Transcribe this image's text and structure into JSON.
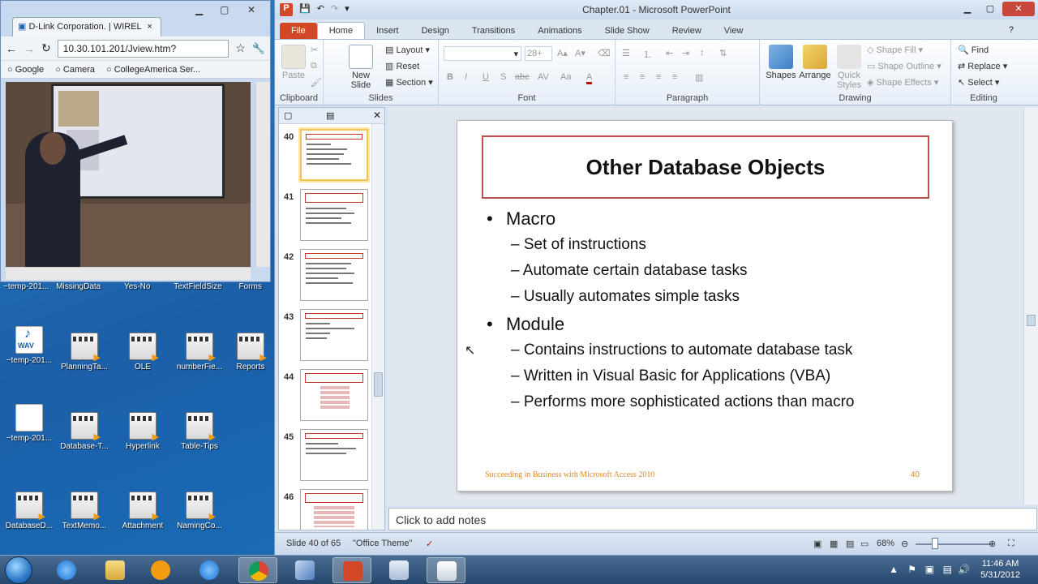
{
  "browser": {
    "tab_title": "D-Link Corporation. | WIREL",
    "url": "10.30.101.201/Jview.htm?",
    "bookmarks": [
      "Google",
      "Camera",
      "CollegeAmerica Ser..."
    ],
    "strip_labels": [
      "~temp-201...",
      "MissingData",
      "Yes-No",
      "TextFieldSize",
      "Forms"
    ]
  },
  "desktop": {
    "icons": [
      {
        "label": "~temp-201...",
        "type": "wav"
      },
      {
        "label": "PlanningTa...",
        "type": "video"
      },
      {
        "label": "OLE",
        "type": "video"
      },
      {
        "label": "numberFie...",
        "type": "video"
      },
      {
        "label": "Reports",
        "type": "video"
      },
      {
        "label": "~temp-201...",
        "type": "doc"
      },
      {
        "label": "Database-T...",
        "type": "video"
      },
      {
        "label": "Hyperlink",
        "type": "video"
      },
      {
        "label": "Table-Tips",
        "type": "video"
      },
      {
        "label": "DatabaseD...",
        "type": "video"
      },
      {
        "label": "TextMemo...",
        "type": "video"
      },
      {
        "label": "Attachment",
        "type": "video"
      },
      {
        "label": "NamingCo...",
        "type": "video"
      }
    ],
    "wav_text": "WAV"
  },
  "ppt": {
    "window_title": "Chapter.01 - Microsoft PowerPoint",
    "app_letter": "P",
    "tabs": [
      "File",
      "Home",
      "Insert",
      "Design",
      "Transitions",
      "Animations",
      "Slide Show",
      "Review",
      "View"
    ],
    "active_tab": "Home",
    "ribbon": {
      "groups": [
        "Clipboard",
        "Slides",
        "Font",
        "Paragraph",
        "Drawing",
        "Editing"
      ],
      "paste": "Paste",
      "new_slide": "New Slide",
      "layout": "Layout",
      "reset": "Reset",
      "section": "Section",
      "font_size": "28+",
      "font_buttons": [
        "B",
        "I",
        "U",
        "S",
        "abc",
        "AV",
        "Aa",
        "A"
      ],
      "shapes": "Shapes",
      "arrange": "Arrange",
      "quick_styles": "Quick Styles",
      "shape_fill": "Shape Fill",
      "shape_outline": "Shape Outline",
      "shape_effects": "Shape Effects",
      "find": "Find",
      "replace": "Replace",
      "select": "Select"
    },
    "thumbnails": [
      {
        "num": "40",
        "selected": true
      },
      {
        "num": "41",
        "selected": false
      },
      {
        "num": "42",
        "selected": false
      },
      {
        "num": "43",
        "selected": false
      },
      {
        "num": "44",
        "selected": false
      },
      {
        "num": "45",
        "selected": false
      },
      {
        "num": "46",
        "selected": false
      }
    ],
    "slide": {
      "title": "Other Database Objects",
      "bullets": [
        {
          "text": "Macro",
          "subs": [
            "– Set of instructions",
            "– Automate certain database tasks",
            "– Usually automates simple tasks"
          ]
        },
        {
          "text": "Module",
          "subs": [
            "– Contains instructions to automate database task",
            "– Written in Visual Basic for Applications (VBA)",
            "– Performs more sophisticated actions than macro"
          ]
        }
      ],
      "footer": "Succeeding in Business with Microsoft Access 2010",
      "page_number": "40"
    },
    "notes_placeholder": "Click to add notes",
    "status": {
      "slide_of": "Slide 40 of 65",
      "theme": "\"Office Theme\"",
      "zoom": "68%"
    }
  },
  "taskbar": {
    "time": "11:46 AM",
    "date": "5/31/2012"
  },
  "colors": {
    "accent_file_tab": "#d24726",
    "title_border": "#c0504d",
    "footer_text": "#e08a2a",
    "selected_thumb": "#f3c35a"
  }
}
